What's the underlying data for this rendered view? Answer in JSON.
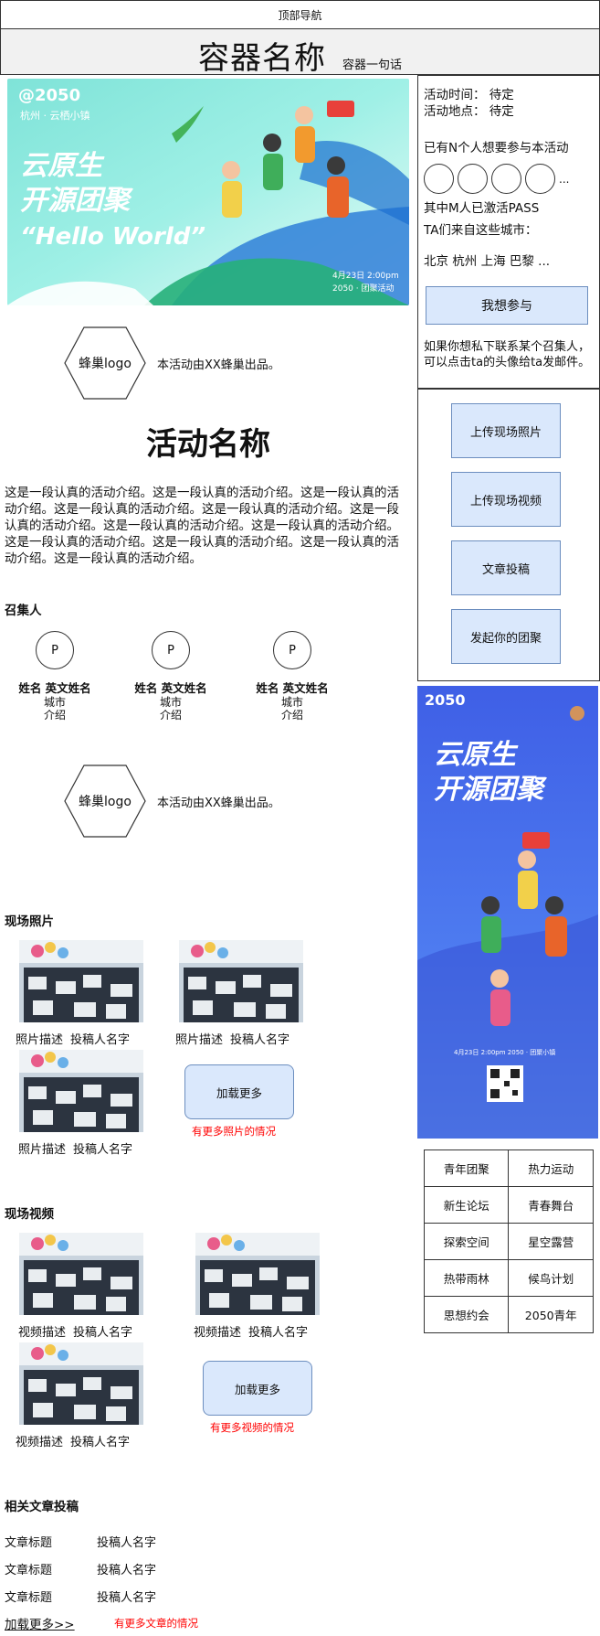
{
  "top_nav": {
    "label": "顶部导航"
  },
  "header": {
    "title": "容器名称",
    "subtitle": "容器一句话"
  },
  "banner": {
    "badge_brand": "@2050",
    "badge_location": "杭州 · 云栖小镇",
    "headline_1": "云原生",
    "headline_2": "开源团聚",
    "slogan": "“Hello World”",
    "date_line": "4月23日 2:00pm",
    "footer_line": "2050 · 团聚活动"
  },
  "producer_1": {
    "logo_label": "蜂巢logo",
    "text": "本活动由XX蜂巢出品。"
  },
  "activity": {
    "name": "活动名称",
    "intro": "这是一段认真的活动介绍。这是一段认真的活动介绍。这是一段认真的活动介绍。这是一段认真的活动介绍。这是一段认真的活动介绍。这是一段认真的活动介绍。这是一段认真的活动介绍。这是一段认真的活动介绍。这是一段认真的活动介绍。这是一段认真的活动介绍。这是一段认真的活动介绍。这是一段认真的活动介绍。"
  },
  "organizers": {
    "title": "召集人",
    "items": [
      {
        "avatar": "P",
        "name": "姓名 英文姓名",
        "city": "城市",
        "intro": "介绍"
      },
      {
        "avatar": "P",
        "name": "姓名 英文姓名",
        "city": "城市",
        "intro": "介绍"
      },
      {
        "avatar": "P",
        "name": "姓名 英文姓名",
        "city": "城市",
        "intro": "介绍"
      }
    ]
  },
  "producer_2": {
    "logo_label": "蜂巢logo",
    "text": "本活动由XX蜂巢出品。"
  },
  "photos": {
    "title": "现场照片",
    "items": [
      {
        "desc": "照片描述",
        "author": "投稿人名字"
      },
      {
        "desc": "照片描述",
        "author": "投稿人名字"
      },
      {
        "desc": "照片描述",
        "author": "投稿人名字"
      }
    ],
    "load_more": "加载更多",
    "hint": "有更多照片的情况"
  },
  "videos": {
    "title": "现场视频",
    "items": [
      {
        "desc": "视频描述",
        "author": "投稿人名字"
      },
      {
        "desc": "视频描述",
        "author": "投稿人名字"
      },
      {
        "desc": "视频描述",
        "author": "投稿人名字"
      }
    ],
    "load_more": "加载更多",
    "hint": "有更多视频的情况"
  },
  "articles": {
    "title": "相关文章投稿",
    "items": [
      {
        "title": "文章标题",
        "author": "投稿人名字"
      },
      {
        "title": "文章标题",
        "author": "投稿人名字"
      },
      {
        "title": "文章标题",
        "author": "投稿人名字"
      }
    ],
    "load_more": "加载更多>>",
    "hint": "有更多文章的情况"
  },
  "side": {
    "time": "活动时间：  待定",
    "place": "活动地点：  待定",
    "want_join": "已有N个人想要参与本活动",
    "ellipsis": "...",
    "activated": "其中M人已激活PASS",
    "cities_title": "TA们来自这些城市：",
    "cities": "北京 杭州 上海 巴黎 ...",
    "join_button": "我想参与",
    "contact_note": "如果你想私下联系某个召集人，可以点击ta的头像给ta发邮件。",
    "actions": [
      "上传现场照片",
      "上传现场视频",
      "文章投稿",
      "发起你的团聚"
    ]
  },
  "poster": {
    "brand": "2050",
    "headline_1": "云原生",
    "headline_2": "开源团聚",
    "date_line": "4月23日 2:00pm 2050 · 团聚小镇"
  },
  "tags": [
    [
      "青年团聚",
      "热力运动"
    ],
    [
      "新生论坛",
      "青春舞台"
    ],
    [
      "探索空间",
      "星空露营"
    ],
    [
      "热带雨林",
      "候鸟计划"
    ],
    [
      "思想约会",
      "2050青年"
    ]
  ],
  "colors": {
    "button_fill": "#dae8fc",
    "button_border": "#6c8ebf",
    "hint_red": "#ff0000",
    "header_bg": "#f1f1f1"
  }
}
